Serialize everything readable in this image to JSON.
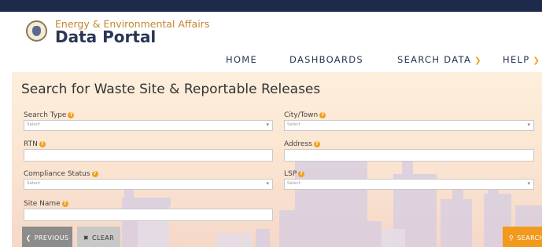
{
  "header": {
    "org_name": "Energy & Environmental Affairs",
    "portal_name": "Data Portal"
  },
  "nav": [
    {
      "label": "HOME",
      "has_dropdown": false
    },
    {
      "label": "DASHBOARDS",
      "has_dropdown": false
    },
    {
      "label": "SEARCH DATA",
      "has_dropdown": true
    },
    {
      "label": "HELP",
      "has_dropdown": true
    }
  ],
  "main": {
    "title": "Search for Waste Site & Reportable Releases"
  },
  "form": {
    "search_type": {
      "label": "Search Type",
      "value": "",
      "placeholder": "Select"
    },
    "city_town": {
      "label": "City/Town",
      "value": "",
      "placeholder": "Select"
    },
    "rtn": {
      "label": "RTN",
      "value": "",
      "placeholder": ""
    },
    "address": {
      "label": "Address",
      "value": "",
      "placeholder": ""
    },
    "compliance_status": {
      "label": "Compliance Status",
      "value": "",
      "placeholder": "Select"
    },
    "lsp": {
      "label": "LSP",
      "value": "",
      "placeholder": "Select"
    },
    "site_name": {
      "label": "Site Name",
      "value": "",
      "placeholder": ""
    }
  },
  "buttons": {
    "previous": "PREVIOUS",
    "clear": "CLEAR",
    "search": "SEARCH"
  },
  "icons": {
    "info": "info-icon",
    "chevron_down": "chevron-down-icon",
    "chevron_left": "chevron-left-icon",
    "close": "close-icon",
    "search": "search-icon"
  },
  "colors": {
    "accent": "#f0a020",
    "navy": "#2a3655",
    "topbar": "#1d2a4a",
    "search_button": "#f19a1d",
    "previous_button": "#8c8c8c",
    "clear_button": "#c8c8c8"
  }
}
